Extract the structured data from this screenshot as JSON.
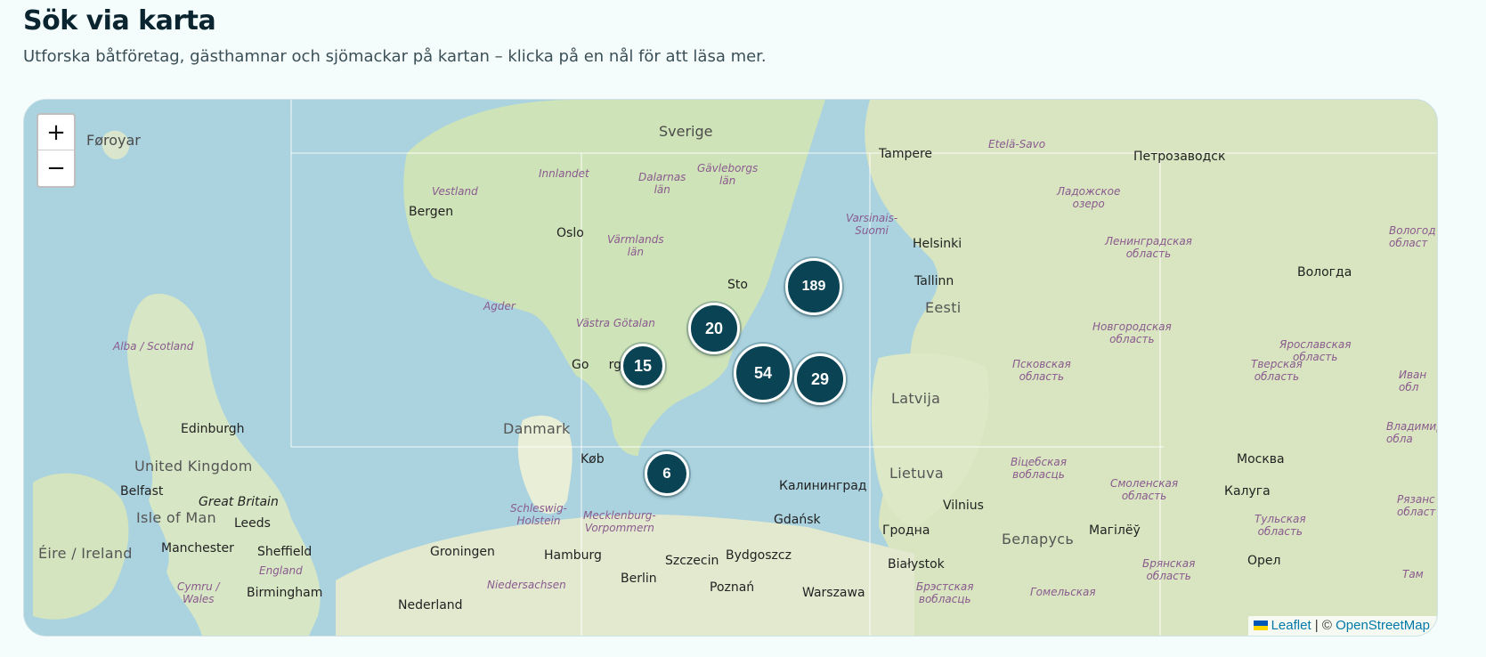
{
  "header": {
    "title": "Sök via karta",
    "subtitle": "Utforska båtföretag, gästhamnar och sjömackar på kartan – klicka på en nål för att läsa mer."
  },
  "zoom": {
    "in_label": "+",
    "out_label": "−"
  },
  "clusters": [
    {
      "count": "189"
    },
    {
      "count": "20"
    },
    {
      "count": "15"
    },
    {
      "count": "54"
    },
    {
      "count": "29"
    },
    {
      "count": "6"
    }
  ],
  "map_labels": {
    "foroyar": "Føroyar",
    "sverige": "Sverige",
    "tampere": "Tampere",
    "etela_savo": "Etelä-Savo",
    "petrozavodsk": "Петрозаводск",
    "innlandet": "Innlandet",
    "dalarnas": "Dalarnas\nlän",
    "gavleborgs": "Gävleborgs\nlän",
    "vestland": "Vestland",
    "bergen": "Bergen",
    "oslo": "Oslo",
    "varmlands": "Värmlands\nlän",
    "varsinais": "Varsinais-\nSuomi",
    "helsinki": "Helsinki",
    "ladozhskoe": "Ладожское\nозеро",
    "leningradskaya": "Ленинградская\nобласть",
    "vologda_obl": "Вологод\nобласт",
    "vologda": "Вологда",
    "tallinn": "Tallinn",
    "eesti": "Eesti",
    "agder": "Agder",
    "alba": "Alba / Scotland",
    "vastra": "Västra Götalan",
    "novgorodskaya": "Новгородская\nобласть",
    "yaroslavskaya": "Ярославская\nобласть",
    "pskovskaya": "Псковская\nобласть",
    "tverskaya": "Тверская\nобласть",
    "ivan": "Иван\nобл",
    "latvija": "Latvija",
    "danmark": "Danmark",
    "edinburgh": "Edinburgh",
    "vladimir": "Владимир\nобла",
    "united_kingdom": "United Kingdom",
    "moskva": "Москва",
    "kobenhavn": "Køb",
    "lietuva": "Lietuva",
    "vitebsk": "Віцебская\nвобласць",
    "belfast": "Belfast",
    "great_britain": "Great Britain",
    "kaliningrad": "Калининград",
    "smolensk": "Смоленская\nобласть",
    "kaluga": "Калуга",
    "ryazan": "Рязанс\nобласт",
    "isle_of_man": "Isle of Man",
    "leeds": "Leeds",
    "schleswig": "Schleswig-\nHolstein",
    "gdansk": "Gdańsk",
    "vilnius": "Vilnius",
    "tula": "Тульская\nобласть",
    "eire": "Éire / Ireland",
    "manchester": "Manchester",
    "sheffield": "Sheffield",
    "mecklenburg": "Mecklenburg-\nVorpommern",
    "groningen": "Groningen",
    "hamburg": "Hamburg",
    "grodno": "Гродна",
    "belarus": "Беларусь",
    "mogilev": "Магілёў",
    "england": "England",
    "szczecin": "Szczecin",
    "bydgoszcz": "Bydgoszcz",
    "bialystok": "Białystok",
    "bryansk": "Брянская\nобласть",
    "orel": "Орел",
    "cymru": "Cymru /\nWales",
    "birmingham": "Birmingham",
    "berlin": "Berlin",
    "niedersachsen": "Niedersachsen",
    "poznan": "Poznań",
    "warszawa": "Warszawa",
    "brest": "Брэстская\nвобласць",
    "gomel": "Гомельская",
    "tam": "Там",
    "nederland": "Nederland",
    "stockholm": "Sto",
    "goteborg": "Go     rg"
  },
  "attribution": {
    "leaflet": "Leaflet",
    "separator": " | © ",
    "osm": "OpenStreetMap"
  },
  "colors": {
    "water": "#aad3df",
    "land": "#f2efe9",
    "forest": "#c8dfb0",
    "cluster": "#0a4353",
    "background": "#f4fdfc"
  }
}
